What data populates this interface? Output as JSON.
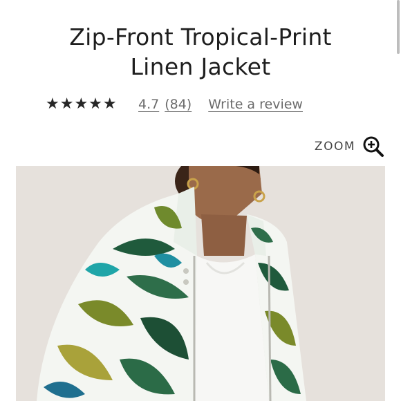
{
  "product": {
    "title_line1": "Zip-Front Tropical-Print",
    "title_line2": "Linen Jacket"
  },
  "rating": {
    "stars_value": 4.7,
    "stars_max": 5,
    "stars_glyphs": "★★★★★",
    "score_text": "4.7",
    "count_text": "(84)",
    "write_review_label": "Write a review"
  },
  "zoom": {
    "label": "ZOOM",
    "icon": "zoom-in-icon"
  },
  "colors": {
    "text": "#1e1e1e",
    "link": "#6b6b6b",
    "star": "#262626",
    "photo_background": "#e6e1dc"
  }
}
